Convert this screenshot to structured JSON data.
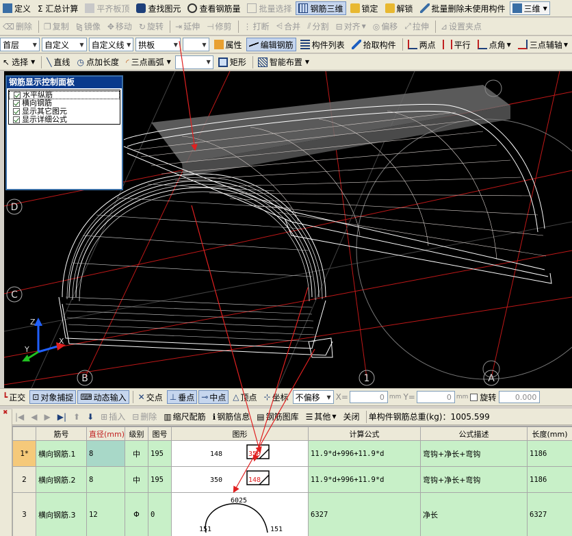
{
  "toolbar1": {
    "items": [
      {
        "label": "定义",
        "on": false,
        "dis": false,
        "icon": "define-icon"
      },
      {
        "label": "Σ 汇总计算",
        "on": false,
        "dis": false,
        "icon": "sum-icon"
      },
      {
        "label": "平齐板顶",
        "on": false,
        "dis": true,
        "icon": "align-top-icon"
      },
      {
        "label": "查找图元",
        "on": false,
        "dis": false,
        "icon": "binoculars-icon"
      },
      {
        "label": "查看钢筋量",
        "on": false,
        "dis": false,
        "icon": "view-rebar-icon"
      },
      {
        "label": "批量选择",
        "on": false,
        "dis": true,
        "icon": "batch-select-icon"
      },
      {
        "label": "钢筋三维",
        "on": true,
        "dis": false,
        "icon": "rebar-3d-icon"
      },
      {
        "label": "锁定",
        "on": false,
        "dis": false,
        "icon": "lock-icon"
      },
      {
        "label": "解锁",
        "on": false,
        "dis": false,
        "icon": "unlock-icon"
      },
      {
        "label": "批量删除未使用构件",
        "on": false,
        "dis": false,
        "icon": "brush-icon"
      },
      {
        "label": "三维",
        "on": false,
        "dis": false,
        "icon": "cube-icon"
      }
    ]
  },
  "toolbar2": {
    "items": [
      "删除",
      "复制",
      "镜像",
      "移动",
      "旋转",
      "延伸",
      "修剪",
      "打断",
      "合并",
      "分割",
      "对齐",
      "偏移",
      "拉伸",
      "设置夹点"
    ]
  },
  "toolbar3": {
    "floor": "首层",
    "type": "自定义",
    "sub": "自定义线",
    "name": "拱板",
    "name_value": "",
    "properties": "属性",
    "edit_rebar": "编辑钢筋",
    "component_list": "构件列表",
    "pick": "拾取构件",
    "two_points": "两点",
    "parallel": "平行",
    "point_angle": "点角",
    "aux": "三点辅轴"
  },
  "toolbar4": {
    "select": "选择",
    "line": "直线",
    "point_length": "点加长度",
    "arc": "三点画弧",
    "blank": "",
    "rect": "矩形",
    "smart": "智能布置"
  },
  "panel": {
    "title": "钢筋显示控制面板",
    "items": [
      "水平纵筋",
      "横向钢筋",
      "显示其它图元",
      "显示详细公式"
    ]
  },
  "axes": {
    "d": "D",
    "c": "C",
    "b": "B",
    "one": "1",
    "a": "A",
    "x": "X",
    "y": "Y",
    "z": "Z"
  },
  "snapbar": {
    "ortho": "正交",
    "snap": "对象捕捉",
    "dynamic": "动态输入",
    "intersect": "交点",
    "perp": "垂点",
    "mid": "中点",
    "vertex": "顶点",
    "coord": "坐标",
    "offset": "不偏移",
    "x_label": "X=",
    "x_val": "0",
    "y_label": "Y=",
    "y_val": "0",
    "unit": "mm",
    "rotate": "旋转",
    "rotate_val": "0.000"
  },
  "gridbar": {
    "insert": "插入",
    "delete": "删除",
    "scale": "缩尺配筋",
    "info": "钢筋信息",
    "library": "钢筋图库",
    "other": "其他",
    "close": "关闭",
    "total_label": "单构件钢筋总重(kg)：",
    "total_value": "1005.599"
  },
  "table": {
    "headers": [
      "筋号",
      "直径(mm)",
      "级别",
      "图号",
      "图形",
      "计算公式",
      "公式描述",
      "长度(mm)"
    ],
    "rows": [
      {
        "idx": "1*",
        "name": "横向钢筋.1",
        "dia": "8",
        "grade": "中",
        "fig": "195",
        "a": "148",
        "b": "350",
        "formula": "11.9*d+996+11.9*d",
        "desc": "弯钩+净长+弯钩",
        "len": "1186"
      },
      {
        "idx": "2",
        "name": "横向钢筋.2",
        "dia": "8",
        "grade": "中",
        "fig": "195",
        "a": "350",
        "b": "148",
        "formula": "11.9*d+996+11.9*d",
        "desc": "弯钩+净长+弯钩",
        "len": "1186"
      },
      {
        "idx": "3",
        "name": "横向钢筋.3",
        "dia": "12",
        "grade": "Φ",
        "fig": "0",
        "a": "6025",
        "b": "151",
        "c": "151",
        "formula": "6327",
        "desc": "净长",
        "len": "6327"
      }
    ]
  },
  "colors": {
    "accent": "#0a3a8c",
    "viewport": "#000000",
    "row": "#c8f0c8",
    "annot": "#e02020"
  }
}
